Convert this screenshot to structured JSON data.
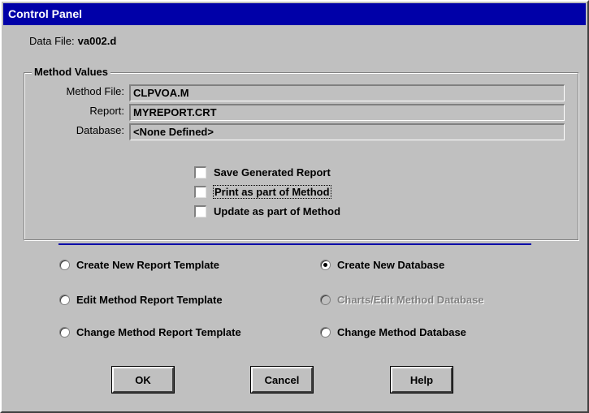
{
  "window": {
    "title": "Control Panel"
  },
  "data_file": {
    "label": "Data File:",
    "value": "va002.d"
  },
  "method_values": {
    "legend": "Method Values",
    "method_file": {
      "label": "Method File:",
      "value": "CLPVOA.M"
    },
    "report": {
      "label": "Report:",
      "value": "MYREPORT.CRT"
    },
    "database": {
      "label": "Database:",
      "value": "<None Defined>"
    }
  },
  "checkboxes": {
    "save_generated_report": {
      "label": "Save Generated Report",
      "checked": false
    },
    "print_as_part_of_method": {
      "label": "Print as part of Method",
      "checked": false
    },
    "update_as_part_of_method": {
      "label": "Update as part of Method",
      "checked": false
    }
  },
  "report_options": {
    "create_new_template": "Create New Report Template",
    "edit_method_template": "Edit Method Report Template",
    "change_method_template": "Change Method Report Template"
  },
  "database_options": {
    "create_new_database": "Create New Database",
    "charts_edit_database": "Charts/Edit Method Database",
    "change_method_database": "Change Method Database",
    "selected": "Create New Database"
  },
  "buttons": {
    "ok": "OK",
    "cancel": "Cancel",
    "help": "Help"
  }
}
